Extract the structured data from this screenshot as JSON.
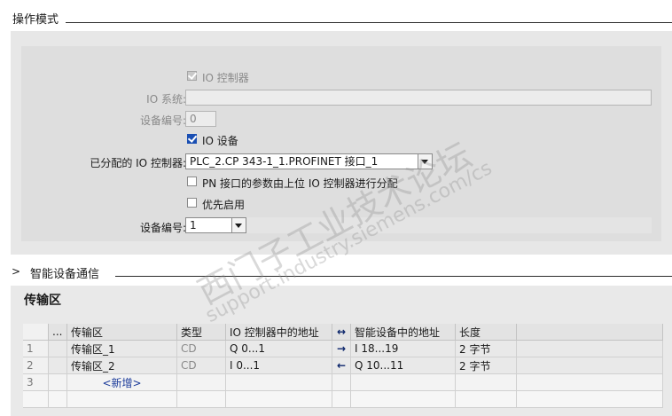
{
  "section1": {
    "title": "操作模式"
  },
  "form": {
    "io_controller_label": "IO 控制器",
    "io_system_label": "IO 系统:",
    "device_number_label": "设备编号:",
    "device_number_value": "0",
    "io_device_label": "IO 设备",
    "assigned_controller_label": "已分配的 IO 控制器:",
    "assigned_controller_value": "PLC_2.CP 343-1_1.PROFINET 接口_1",
    "pn_params_label": "PN 接口的参数由上位 IO 控制器进行分配",
    "priority_label": "优先启用",
    "device_number2_label": "设备编号:",
    "device_number2_value": "1"
  },
  "section2": {
    "title": "智能设备通信",
    "chevron": ">"
  },
  "transfer": {
    "heading": "传输区",
    "columns": [
      "",
      "...",
      "传输区",
      "类型",
      "IO 控制器中的地址",
      "↔",
      "智能设备中的地址",
      "长度"
    ],
    "rows": [
      {
        "num": "1",
        "name": "传输区_1",
        "type": "CD",
        "ctrl_addr": "Q 0...1",
        "dir": "→",
        "dev_addr": "I 18...19",
        "length": "2 字节"
      },
      {
        "num": "2",
        "name": "传输区_2",
        "type": "CD",
        "ctrl_addr": "I 0...1",
        "dir": "←",
        "dev_addr": "Q 10...11",
        "length": "2 字节"
      }
    ],
    "new_row": {
      "num": "3",
      "label": "<新增>"
    }
  },
  "watermark": {
    "line1": "西门子工业技术论坛",
    "line2": "support.industry.siemens.com/cs"
  },
  "colors": {
    "checkbox_blue": "#1a4fb3",
    "panel_bg": "#e7e7e7",
    "link_blue": "#1a3a9a"
  }
}
